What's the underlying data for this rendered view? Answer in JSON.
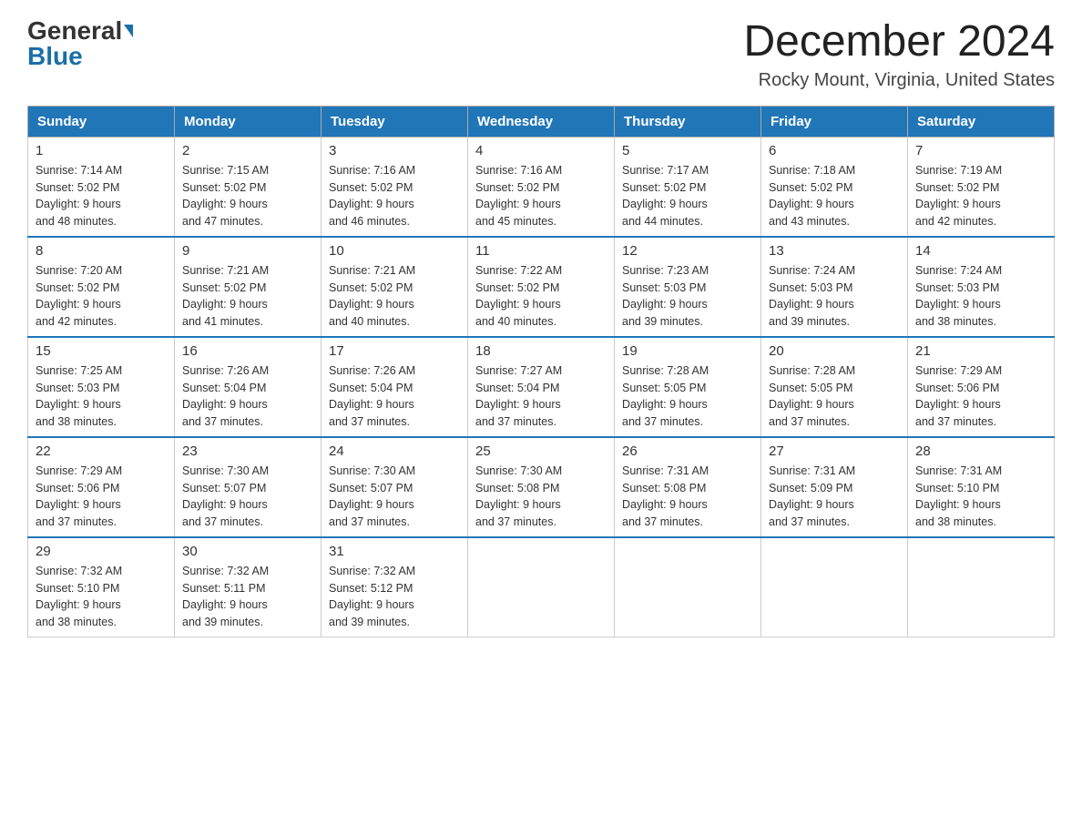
{
  "header": {
    "logo_general": "General",
    "logo_blue": "Blue",
    "month_title": "December 2024",
    "location": "Rocky Mount, Virginia, United States"
  },
  "weekdays": [
    "Sunday",
    "Monday",
    "Tuesday",
    "Wednesday",
    "Thursday",
    "Friday",
    "Saturday"
  ],
  "weeks": [
    [
      {
        "day": "1",
        "sunrise": "7:14 AM",
        "sunset": "5:02 PM",
        "daylight": "9 hours and 48 minutes."
      },
      {
        "day": "2",
        "sunrise": "7:15 AM",
        "sunset": "5:02 PM",
        "daylight": "9 hours and 47 minutes."
      },
      {
        "day": "3",
        "sunrise": "7:16 AM",
        "sunset": "5:02 PM",
        "daylight": "9 hours and 46 minutes."
      },
      {
        "day": "4",
        "sunrise": "7:16 AM",
        "sunset": "5:02 PM",
        "daylight": "9 hours and 45 minutes."
      },
      {
        "day": "5",
        "sunrise": "7:17 AM",
        "sunset": "5:02 PM",
        "daylight": "9 hours and 44 minutes."
      },
      {
        "day": "6",
        "sunrise": "7:18 AM",
        "sunset": "5:02 PM",
        "daylight": "9 hours and 43 minutes."
      },
      {
        "day": "7",
        "sunrise": "7:19 AM",
        "sunset": "5:02 PM",
        "daylight": "9 hours and 42 minutes."
      }
    ],
    [
      {
        "day": "8",
        "sunrise": "7:20 AM",
        "sunset": "5:02 PM",
        "daylight": "9 hours and 42 minutes."
      },
      {
        "day": "9",
        "sunrise": "7:21 AM",
        "sunset": "5:02 PM",
        "daylight": "9 hours and 41 minutes."
      },
      {
        "day": "10",
        "sunrise": "7:21 AM",
        "sunset": "5:02 PM",
        "daylight": "9 hours and 40 minutes."
      },
      {
        "day": "11",
        "sunrise": "7:22 AM",
        "sunset": "5:02 PM",
        "daylight": "9 hours and 40 minutes."
      },
      {
        "day": "12",
        "sunrise": "7:23 AM",
        "sunset": "5:03 PM",
        "daylight": "9 hours and 39 minutes."
      },
      {
        "day": "13",
        "sunrise": "7:24 AM",
        "sunset": "5:03 PM",
        "daylight": "9 hours and 39 minutes."
      },
      {
        "day": "14",
        "sunrise": "7:24 AM",
        "sunset": "5:03 PM",
        "daylight": "9 hours and 38 minutes."
      }
    ],
    [
      {
        "day": "15",
        "sunrise": "7:25 AM",
        "sunset": "5:03 PM",
        "daylight": "9 hours and 38 minutes."
      },
      {
        "day": "16",
        "sunrise": "7:26 AM",
        "sunset": "5:04 PM",
        "daylight": "9 hours and 37 minutes."
      },
      {
        "day": "17",
        "sunrise": "7:26 AM",
        "sunset": "5:04 PM",
        "daylight": "9 hours and 37 minutes."
      },
      {
        "day": "18",
        "sunrise": "7:27 AM",
        "sunset": "5:04 PM",
        "daylight": "9 hours and 37 minutes."
      },
      {
        "day": "19",
        "sunrise": "7:28 AM",
        "sunset": "5:05 PM",
        "daylight": "9 hours and 37 minutes."
      },
      {
        "day": "20",
        "sunrise": "7:28 AM",
        "sunset": "5:05 PM",
        "daylight": "9 hours and 37 minutes."
      },
      {
        "day": "21",
        "sunrise": "7:29 AM",
        "sunset": "5:06 PM",
        "daylight": "9 hours and 37 minutes."
      }
    ],
    [
      {
        "day": "22",
        "sunrise": "7:29 AM",
        "sunset": "5:06 PM",
        "daylight": "9 hours and 37 minutes."
      },
      {
        "day": "23",
        "sunrise": "7:30 AM",
        "sunset": "5:07 PM",
        "daylight": "9 hours and 37 minutes."
      },
      {
        "day": "24",
        "sunrise": "7:30 AM",
        "sunset": "5:07 PM",
        "daylight": "9 hours and 37 minutes."
      },
      {
        "day": "25",
        "sunrise": "7:30 AM",
        "sunset": "5:08 PM",
        "daylight": "9 hours and 37 minutes."
      },
      {
        "day": "26",
        "sunrise": "7:31 AM",
        "sunset": "5:08 PM",
        "daylight": "9 hours and 37 minutes."
      },
      {
        "day": "27",
        "sunrise": "7:31 AM",
        "sunset": "5:09 PM",
        "daylight": "9 hours and 37 minutes."
      },
      {
        "day": "28",
        "sunrise": "7:31 AM",
        "sunset": "5:10 PM",
        "daylight": "9 hours and 38 minutes."
      }
    ],
    [
      {
        "day": "29",
        "sunrise": "7:32 AM",
        "sunset": "5:10 PM",
        "daylight": "9 hours and 38 minutes."
      },
      {
        "day": "30",
        "sunrise": "7:32 AM",
        "sunset": "5:11 PM",
        "daylight": "9 hours and 39 minutes."
      },
      {
        "day": "31",
        "sunrise": "7:32 AM",
        "sunset": "5:12 PM",
        "daylight": "9 hours and 39 minutes."
      },
      null,
      null,
      null,
      null
    ]
  ],
  "labels": {
    "sunrise": "Sunrise:",
    "sunset": "Sunset:",
    "daylight": "Daylight:"
  }
}
